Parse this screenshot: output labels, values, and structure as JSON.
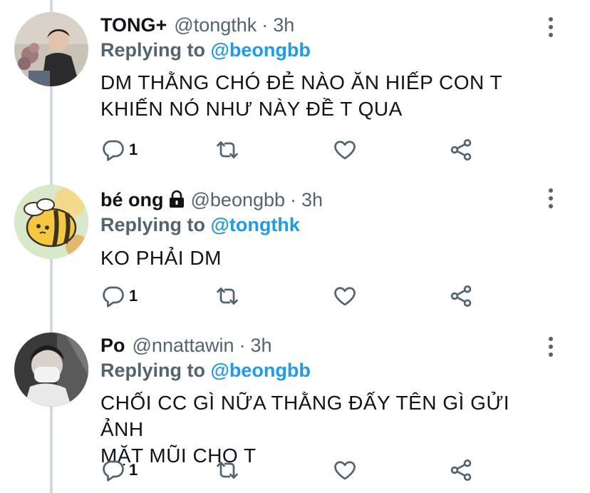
{
  "tweets": [
    {
      "display_name": "TONG+",
      "handle": "@tongthk",
      "separator": "·",
      "time": "3h",
      "replying_prefix": "Replying to",
      "replying_to": "@beongbb",
      "text_lines": [
        "DM THẰNG CHÓ ĐẺ NÀO ĂN HIẾP CON T",
        "KHIẾN NÓ NHƯ NÀY ĐỀ T QUA"
      ],
      "reply_count": "1",
      "locked": false
    },
    {
      "display_name": "bé ong",
      "handle": "@beongbb",
      "separator": "·",
      "time": "3h",
      "replying_prefix": "Replying to",
      "replying_to": "@tongthk",
      "text_lines": [
        "KO PHẢI DM"
      ],
      "reply_count": "1",
      "locked": true
    },
    {
      "display_name": "Po",
      "handle": "@nnattawin",
      "separator": "·",
      "time": "3h",
      "replying_prefix": "Replying to",
      "replying_to": "@beongbb",
      "text_lines": [
        "CHỐI CC GÌ NỮA THẰNG ĐẤY TÊN GÌ GỬI ẢNH",
        "MẶT MŨI CHO T"
      ],
      "reply_count": "1",
      "locked": false
    }
  ],
  "icons": {
    "reply": "reply-icon",
    "retweet": "retweet-icon",
    "like": "heart-icon",
    "share": "share-icon",
    "more": "more-icon",
    "lock": "lock-icon"
  },
  "colors": {
    "text": "#0f1419",
    "secondary": "#536471",
    "link": "#1d9bf0",
    "thread_line": "#cfd9de"
  }
}
